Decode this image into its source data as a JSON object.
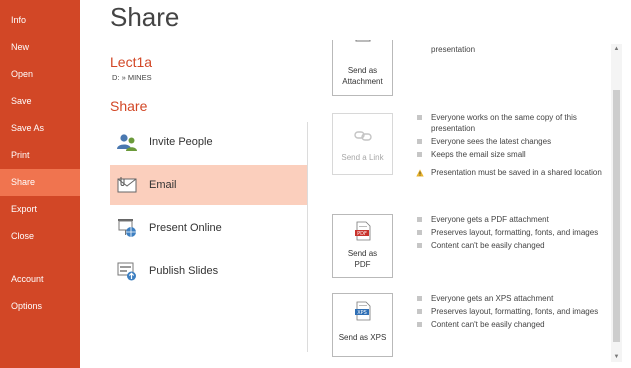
{
  "nav": {
    "items": [
      {
        "label": "Info"
      },
      {
        "label": "New"
      },
      {
        "label": "Open"
      },
      {
        "label": "Save"
      },
      {
        "label": "Save As"
      },
      {
        "label": "Print"
      },
      {
        "label": "Share",
        "active": true
      },
      {
        "label": "Export"
      },
      {
        "label": "Close"
      },
      {
        "label": "Account"
      },
      {
        "label": "Options"
      }
    ]
  },
  "header": {
    "title": "Share",
    "doc_name": "Lect1a",
    "doc_path": "D: » MINES",
    "section_title": "Share"
  },
  "share_options": [
    {
      "label": "Invite People",
      "icon": "invite-people-icon"
    },
    {
      "label": "Email",
      "icon": "email-icon",
      "selected": true
    },
    {
      "label": "Present Online",
      "icon": "present-online-icon"
    },
    {
      "label": "Publish Slides",
      "icon": "publish-slides-icon"
    }
  ],
  "email_panel": {
    "attachment": {
      "label_line1": "Send as",
      "label_line2": "Attachment",
      "bullets": [
        "presentation"
      ]
    },
    "link": {
      "label": "Send a Link",
      "disabled": true,
      "bullets": [
        "Everyone works on the same copy of this presentation",
        "Everyone sees the latest changes",
        "Keeps the email size small"
      ],
      "warning": "Presentation must be saved in a shared location"
    },
    "pdf": {
      "icon_text": "PDF",
      "label_line1": "Send as",
      "label_line2": "PDF",
      "bullets": [
        "Everyone gets a PDF attachment",
        "Preserves layout, formatting, fonts, and images",
        "Content can't be easily changed"
      ]
    },
    "xps": {
      "icon_text": "XPS",
      "label": "Send as XPS",
      "bullets": [
        "Everyone gets an XPS attachment",
        "Preserves layout, formatting, fonts, and images",
        "Content can't be easily changed"
      ]
    }
  },
  "colors": {
    "accent": "#d24726",
    "nav_active": "#f0744f",
    "selected_bg": "#fbcfbd"
  }
}
